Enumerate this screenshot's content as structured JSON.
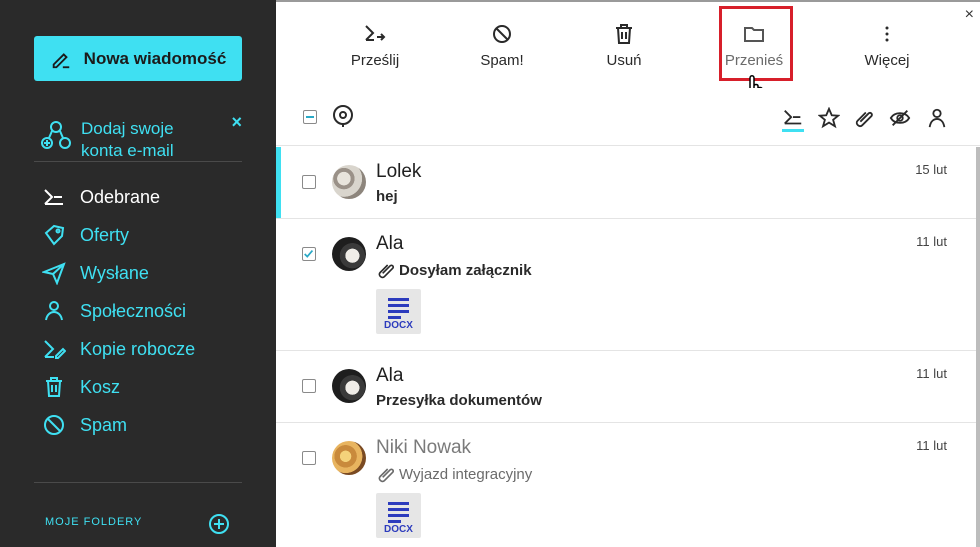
{
  "sidebar": {
    "compose_label": "Nowa wiadomość",
    "add_accounts_line1": "Dodaj swoje",
    "add_accounts_line2": "konta e-mail",
    "close_symbol": "×",
    "folders": [
      {
        "label": "Odebrane",
        "icon": "inbox-icon",
        "active": true
      },
      {
        "label": "Oferty",
        "icon": "tag-icon"
      },
      {
        "label": "Wysłane",
        "icon": "send-icon"
      },
      {
        "label": "Społeczności",
        "icon": "people-icon"
      },
      {
        "label": "Kopie robocze",
        "icon": "draft-icon"
      },
      {
        "label": "Kosz",
        "icon": "trash-icon"
      },
      {
        "label": "Spam",
        "icon": "spam-icon"
      }
    ],
    "my_folders_label": "MOJE FOLDERY"
  },
  "toolbar": {
    "forward_label": "Prześlij",
    "spam_label": "Spam!",
    "delete_label": "Usuń",
    "move_label": "Przenieś",
    "more_label": "Więcej",
    "close_symbol": "×"
  },
  "messages": [
    {
      "sender": "Lolek",
      "subject": "hej",
      "date": "15 lut",
      "checked": false,
      "unread": true
    },
    {
      "sender": "Ala",
      "subject": "Dosyłam załącznik",
      "date": "11 lut",
      "checked": true,
      "attachment": "DOCX"
    },
    {
      "sender": "Ala",
      "subject": "Przesyłka dokumentów",
      "date": "11 lut",
      "checked": false
    },
    {
      "sender": "Niki Nowak",
      "subject": "Wyjazd integracyjny",
      "date": "11 lut",
      "checked": false,
      "attachment": "DOCX",
      "read": true
    }
  ],
  "colors": {
    "accent": "#3fe0f2",
    "sidebar_bg": "#2a2a2a",
    "highlight": "#d71f2a",
    "attachment": "#2c3bbd"
  }
}
